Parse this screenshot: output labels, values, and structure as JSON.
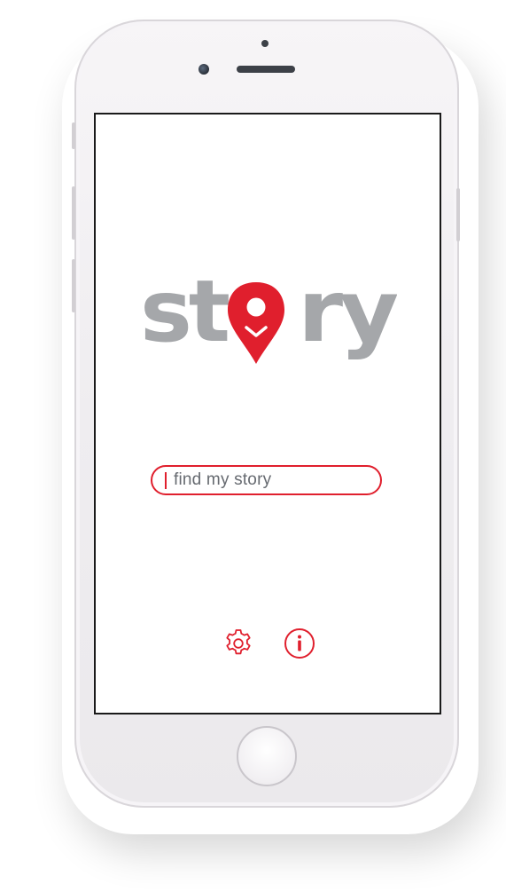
{
  "app": {
    "logo_text": "story"
  },
  "search": {
    "placeholder": "find my story"
  },
  "bottom_icons": [
    {
      "icon": "gear-icon",
      "label": "settings"
    },
    {
      "icon": "info-icon",
      "label": "info"
    }
  ],
  "colors": {
    "brand_red": "#e01f2d",
    "logo_gray": "#a5a7aa",
    "text_gray": "#666a70"
  }
}
